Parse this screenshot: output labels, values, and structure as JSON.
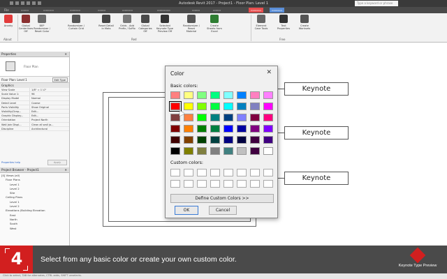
{
  "titlebar": {
    "title": "Autodesk Revit 2017 -  Project1 - Floor Plan: Level 1",
    "search_placeholder": "Type a keyword or phrase"
  },
  "ribbon": {
    "buttons": [
      {
        "label": "Anarky",
        "icon": "anarky-icon",
        "color": "#e23b3b"
      },
      {
        "label": "Global Centerlines Off",
        "icon": "centerlines-icon",
        "color": "#8a3030"
      },
      {
        "label": "BEP Randomizer / Reset Color",
        "icon": "randomizer-icon",
        "color": "#6a6a6a"
      },
      {
        "label": "Randomizer / Curtain Grid",
        "icon": "curtain-grid-icon",
        "color": "#555555"
      },
      {
        "label": "Reset Detail in Mats",
        "icon": "detail-icon",
        "color": "#444444"
      },
      {
        "label": "Grids - Add Prefix / Suffix",
        "icon": "grids-icon",
        "color": "#777777"
      },
      {
        "label": "Global Categories Off",
        "icon": "categories-icon",
        "color": "#4a4a4a"
      },
      {
        "label": "Selected Keynote Type Preview Off",
        "icon": "keynote-icon",
        "color": "#333333"
      },
      {
        "label": "Randomizer / Reset Material",
        "icon": "material-icon",
        "color": "#555555"
      },
      {
        "label": "Create Sheets from Excel",
        "icon": "sheets-icon",
        "color": "#2e7d32"
      },
      {
        "label": "Element Case Tools",
        "icon": "case-icon",
        "color": "#666666"
      },
      {
        "label": "Text Properties",
        "icon": "text-icon",
        "color": "#333333"
      },
      {
        "label": "Create Worksets",
        "icon": "worksets-icon",
        "color": "#555555"
      }
    ],
    "groups": {
      "about": "About",
      "red": "Red",
      "free": "Free"
    }
  },
  "properties": {
    "title": "Properties",
    "type_label": "Floor Plan",
    "selector": "Floor Plan: Level 1",
    "edit_type": "Edit Type",
    "section": "Graphics",
    "rows": [
      {
        "k": "View Scale",
        "v": "1/8\" = 1'-0\""
      },
      {
        "k": "Scale Value    1:",
        "v": "96"
      },
      {
        "k": "Display Model",
        "v": "Normal"
      },
      {
        "k": "Detail Level",
        "v": "Coarse"
      },
      {
        "k": "Parts Visibility",
        "v": "Show Original"
      },
      {
        "k": "Visibility/Grap...",
        "v": "Edit..."
      },
      {
        "k": "Graphic Display...",
        "v": "Edit..."
      },
      {
        "k": "Orientation",
        "v": "Project North"
      },
      {
        "k": "Wall Join Displ...",
        "v": "Clean all wall jo..."
      },
      {
        "k": "Discipline",
        "v": "Architectural"
      }
    ],
    "help": "Properties help",
    "apply": "Apply"
  },
  "browser": {
    "title": "Project Browser - Project1",
    "items": [
      "[0] Views (all)",
      "Floor Plans",
      "Level 1",
      "Level 2",
      "Site",
      "Ceiling Plans",
      "Level 1",
      "Level 2",
      "Elevations (Building Elevation",
      "East",
      "North",
      "South",
      "West"
    ]
  },
  "canvas": {
    "keynotes": [
      "Keynote",
      "Keynote",
      "Keynote"
    ]
  },
  "dialog": {
    "title": "Color",
    "close": "✕",
    "basic_label": "Basic colors:",
    "custom_label": "Custom colors:",
    "define_btn": "Define Custom Colors >>",
    "ok": "OK",
    "cancel": "Cancel",
    "selected_index": 8,
    "basic_colors": [
      "#ff8080",
      "#ffff80",
      "#80ff80",
      "#00ff80",
      "#80ffff",
      "#0080ff",
      "#ff80c0",
      "#ff80ff",
      "#ff0000",
      "#ffff00",
      "#80ff00",
      "#00ff40",
      "#00ffff",
      "#0080c0",
      "#8080c0",
      "#ff00ff",
      "#804040",
      "#ff8040",
      "#00ff00",
      "#008080",
      "#004080",
      "#8080ff",
      "#800040",
      "#ff0080",
      "#800000",
      "#ff8000",
      "#008000",
      "#008040",
      "#0000ff",
      "#0000a0",
      "#800080",
      "#8000ff",
      "#400000",
      "#804000",
      "#004000",
      "#004040",
      "#000080",
      "#000040",
      "#400040",
      "#400080",
      "#000000",
      "#808000",
      "#808040",
      "#808080",
      "#408080",
      "#c0c0c0",
      "#400040",
      "#ffffff"
    ]
  },
  "overlay": {
    "step": "4",
    "caption": "Select from any basic color or create your own custom color.",
    "brand": "Keynote Type Preview",
    "accent": "#d21f1f"
  },
  "statusbar": {
    "text": "Click to select, TAB for alternates, CTRL adds, SHIFT unselects."
  }
}
